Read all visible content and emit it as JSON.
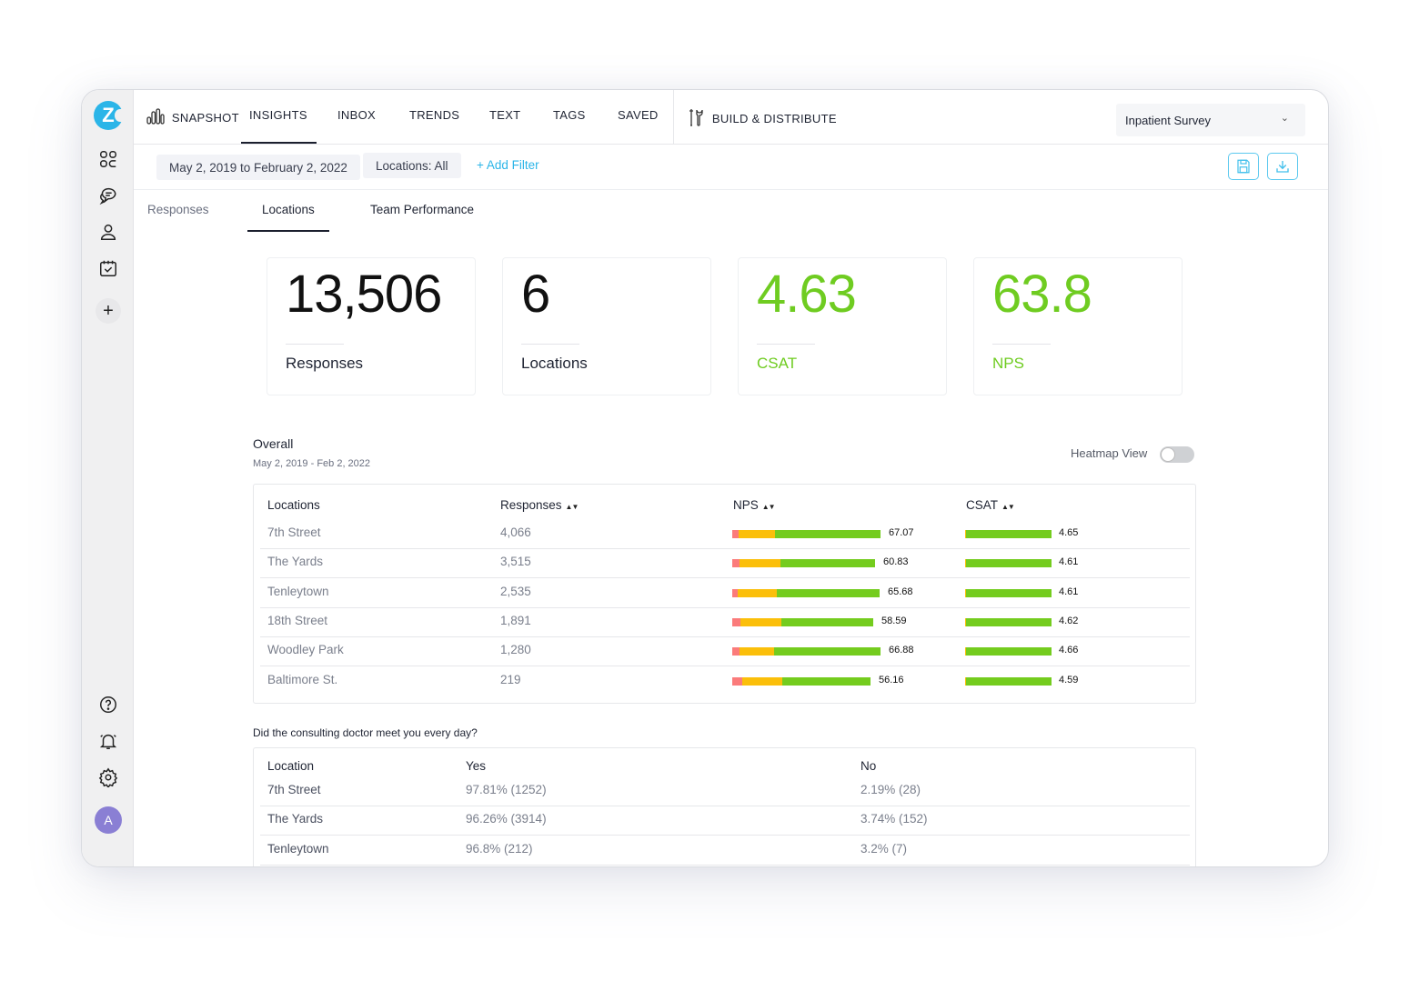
{
  "app": {
    "logo_letter": "Z"
  },
  "nav": {
    "items": [
      {
        "label": "SNAPSHOT",
        "icon": "bar-chart-icon"
      },
      {
        "label": "INSIGHTS",
        "active": true
      },
      {
        "label": "INBOX"
      },
      {
        "label": "TRENDS"
      },
      {
        "label": "TEXT"
      },
      {
        "label": "TAGS"
      },
      {
        "label": "SAVED"
      }
    ],
    "build_label": "BUILD & DISTRIBUTE",
    "survey_select": "Inpatient Survey"
  },
  "sidebar": {
    "top_icons": [
      "dashboard-icon",
      "chat-icon",
      "user-icon",
      "calendar-check-icon",
      "plus-icon"
    ],
    "bottom_icons": [
      "help-icon",
      "bell-icon",
      "gear-icon"
    ],
    "avatar_initial": "A"
  },
  "filters": {
    "date_range": "May 2, 2019 to February 2, 2022",
    "locations": "Locations: All",
    "add_filter": "+ Add Filter",
    "save_icon": "save-icon",
    "download_icon": "download-icon"
  },
  "subtabs": [
    {
      "label": "Responses"
    },
    {
      "label": "Locations",
      "active": true
    },
    {
      "label": "Team Performance"
    }
  ],
  "stats": [
    {
      "value": "13,506",
      "label": "Responses",
      "color": "#111111"
    },
    {
      "value": "6",
      "label": "Locations",
      "color": "#111111"
    },
    {
      "value": "4.63",
      "label": "CSAT",
      "color": "#6fcc21"
    },
    {
      "value": "63.8",
      "label": "NPS",
      "color": "#6fcc21"
    }
  ],
  "overall": {
    "title": "Overall",
    "date_range": "May 2, 2019 - Feb 2, 2022",
    "heatmap_label": "Heatmap View",
    "heatmap_on": false,
    "columns": [
      "Locations",
      "Responses",
      "NPS",
      "CSAT"
    ],
    "colors": {
      "detractor": "#fb7b7b",
      "passive": "#fbbf0a",
      "promoter": "#74cc1e"
    },
    "rows": [
      {
        "location": "7th Street",
        "responses": "4,066",
        "nps": "67.07",
        "csat": "4.65",
        "nps_split": [
          0.04,
          0.25,
          0.71
        ],
        "csat_split": [
          0.01,
          0.99
        ]
      },
      {
        "location": "The Yards",
        "responses": "3,515",
        "nps": "60.83",
        "csat": "4.61",
        "nps_split": [
          0.05,
          0.29,
          0.66
        ],
        "csat_split": [
          0.015,
          0.985
        ]
      },
      {
        "location": "Tenleytown",
        "responses": "2,535",
        "nps": "65.68",
        "csat": "4.61",
        "nps_split": [
          0.04,
          0.26,
          0.7
        ],
        "csat_split": [
          0.015,
          0.985
        ]
      },
      {
        "location": "18th Street",
        "responses": "1,891",
        "nps": "58.59",
        "csat": "4.62",
        "nps_split": [
          0.06,
          0.29,
          0.65
        ],
        "csat_split": [
          0.01,
          0.99
        ]
      },
      {
        "location": "Woodley Park",
        "responses": "1,280",
        "nps": "66.88",
        "csat": "4.66",
        "nps_split": [
          0.05,
          0.23,
          0.72
        ],
        "csat_split": [
          0.01,
          0.99
        ]
      },
      {
        "location": "Baltimore St.",
        "responses": "219",
        "nps": "56.16",
        "csat": "4.59",
        "nps_split": [
          0.07,
          0.29,
          0.64
        ],
        "csat_split": [
          0.015,
          0.985
        ]
      }
    ]
  },
  "question": {
    "title": "Did the consulting doctor meet you every day?",
    "columns": [
      "Location",
      "Yes",
      "No"
    ],
    "rows": [
      {
        "location": "7th Street",
        "yes": "97.81% (1252)",
        "no": "2.19% (28)"
      },
      {
        "location": "The Yards",
        "yes": "96.26% (3914)",
        "no": "3.74% (152)"
      },
      {
        "location": "Tenleytown",
        "yes": "96.8% (212)",
        "no": "3.2% (7)"
      }
    ]
  }
}
